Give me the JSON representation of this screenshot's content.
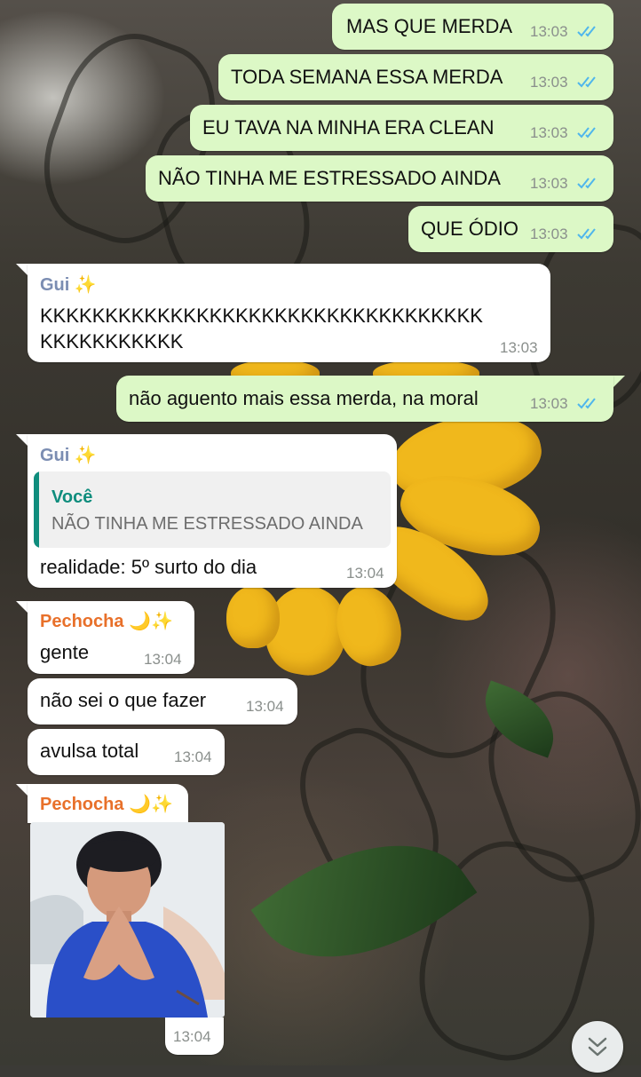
{
  "outgoing_messages": [
    {
      "text": "MAS QUE MERDA",
      "time": "13:03"
    },
    {
      "text": "TODA SEMANA ESSA MERDA",
      "time": "13:03"
    },
    {
      "text": "EU TAVA NA MINHA ERA CLEAN",
      "time": "13:03"
    },
    {
      "text": "NÃO TINHA ME ESTRESSADO AINDA",
      "time": "13:03"
    },
    {
      "text": "QUE ÓDIO",
      "time": "13:03"
    }
  ],
  "gui_message_1": {
    "sender": "Gui ✨",
    "line1": "KKKKKKKKKKKKKKKKKKKKKKKKKKKKKKKKKK",
    "line2": "KKKKKKKKKKK",
    "time": "13:03"
  },
  "outgoing_message_6": {
    "text": "não aguento mais essa merda, na moral",
    "time": "13:03"
  },
  "gui_message_2": {
    "sender": "Gui ✨",
    "quote_author": "Você",
    "quote_text": "NÃO TINHA ME ESTRESSADO AINDA",
    "text": "realidade: 5º surto do dia",
    "time": "13:04"
  },
  "pechocha_messages": {
    "sender": "Pechocha 🌙✨",
    "items": [
      {
        "text": "gente",
        "time": "13:04"
      },
      {
        "text": "não sei o que fazer",
        "time": "13:04"
      },
      {
        "text": "avulsa total",
        "time": "13:04"
      }
    ]
  },
  "pechocha_image_message": {
    "sender": "Pechocha 🌙✨",
    "time": "13:04"
  },
  "colors": {
    "outgoing_bubble": "#dcf8c6",
    "incoming_bubble": "#ffffff",
    "gui_name": "#7b8db2",
    "pechocha_name": "#e8702a",
    "quote_author": "#0f8d7d",
    "read_ticks": "#4fb6ec"
  },
  "icons": {
    "read_receipt": "double-check-icon",
    "scroll_down": "chevron-double-down-icon"
  }
}
